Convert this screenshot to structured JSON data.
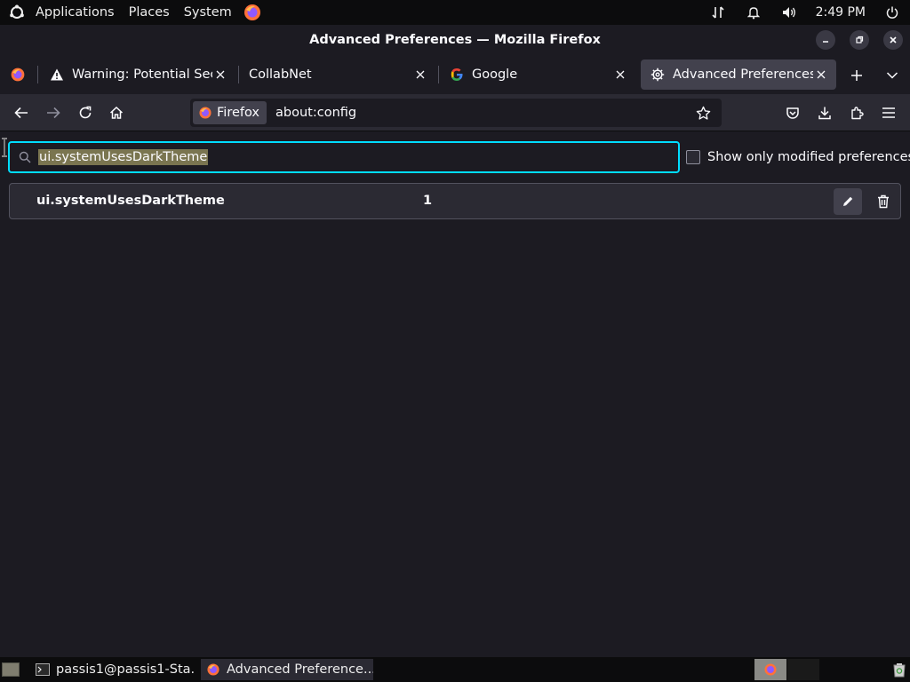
{
  "top_panel": {
    "menus": [
      "Applications",
      "Places",
      "System"
    ],
    "clock": "2:49 PM"
  },
  "window": {
    "title": "Advanced Preferences — Mozilla Firefox"
  },
  "tabs": [
    {
      "label": "Warning: Potential Securi",
      "icon": "warning-icon"
    },
    {
      "label": "CollabNet",
      "icon": "none"
    },
    {
      "label": "Google",
      "icon": "google-icon"
    },
    {
      "label": "Advanced Preferences",
      "icon": "gear-icon",
      "selected": true
    }
  ],
  "urlbar": {
    "identity_label": "Firefox",
    "url": "about:config"
  },
  "config": {
    "search_value": "ui.systemUsesDarkTheme",
    "show_modified_label": "Show only modified preferences",
    "show_modified_checked": false,
    "pref": {
      "name": "ui.systemUsesDarkTheme",
      "value": "1"
    }
  },
  "taskbar": {
    "tasks": [
      {
        "label": "passis1@passis1-Sta...",
        "icon": "terminal-icon"
      },
      {
        "label": "Advanced Preference...",
        "icon": "firefox-icon",
        "active": true
      }
    ]
  },
  "colors": {
    "accent": "#00ddff",
    "background": "#1c1b22",
    "toolbar": "#2b2a33"
  }
}
